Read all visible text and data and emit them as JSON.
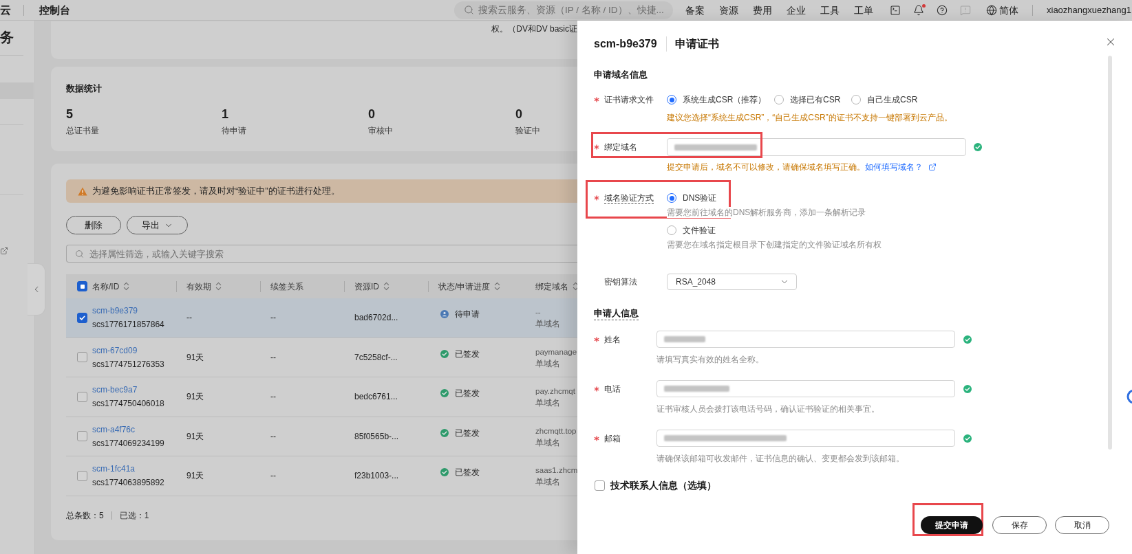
{
  "top_bar": {
    "brand": "云",
    "title": "控制台",
    "search": {
      "placeholder": "搜索云服务、资源（IP / 名称 / ID）、快捷..."
    },
    "nav": [
      "备案",
      "资源",
      "费用",
      "企业",
      "工具",
      "工单"
    ],
    "notifications": {
      "unread": true
    },
    "language": "简体",
    "user": "xiaozhangxuezhang1"
  },
  "sidebar": {
    "heading": "务",
    "items": [
      {
        "selected": true
      }
    ]
  },
  "intro": {
    "text": "权。（DV和DV basic证"
  },
  "stats": {
    "title": "数据统计",
    "items": [
      {
        "value": "5",
        "label": "总证书量"
      },
      {
        "value": "1",
        "label": "待申请"
      },
      {
        "value": "0",
        "label": "审核中"
      },
      {
        "value": "0",
        "label": "验证中"
      }
    ]
  },
  "notice": {
    "text": "为避免影响证书正常签发，请及时对“验证中”的证书进行处理。"
  },
  "toolbar": {
    "buttons": [
      {
        "label": "删除",
        "kind": "plain"
      },
      {
        "label": "导出",
        "kind": "dropdown"
      }
    ]
  },
  "filter": {
    "placeholder": "选择属性筛选，或输入关键字搜索"
  },
  "table": {
    "select_all": {
      "indeterminate": true
    },
    "columns": [
      {
        "label": "名称/ID",
        "sortable": true
      },
      {
        "label": "有效期",
        "sortable": true
      },
      {
        "label": "续签关系",
        "sortable": false
      },
      {
        "label": "资源ID",
        "sortable": true
      },
      {
        "label": "状态/申请进度",
        "sortable": true
      },
      {
        "label": "绑定域名",
        "sortable": true
      }
    ],
    "rows": [
      {
        "selected": true,
        "name": "scm-b9e379",
        "id": "scs1776171857864",
        "validity": "--",
        "renewal": "--",
        "resource_id": "bad6702d...",
        "status": {
          "kind": "pending",
          "label": "待申请"
        },
        "domain": "--",
        "domain_type": "单域名"
      },
      {
        "selected": false,
        "name": "scm-67cd09",
        "id": "scs1774751276353",
        "validity": "91天",
        "renewal": "--",
        "resource_id": "7c5258cf-...",
        "status": {
          "kind": "issued",
          "label": "已签发"
        },
        "domain": "paymanage",
        "domain_type": "单域名"
      },
      {
        "selected": false,
        "name": "scm-bec9a7",
        "id": "scs1774750406018",
        "validity": "91天",
        "renewal": "--",
        "resource_id": "bedc6761...",
        "status": {
          "kind": "issued",
          "label": "已签发"
        },
        "domain": "pay.zhcmqt",
        "domain_type": "单域名"
      },
      {
        "selected": false,
        "name": "scm-a4f76c",
        "id": "scs1774069234199",
        "validity": "91天",
        "renewal": "--",
        "resource_id": "85f0565b-...",
        "status": {
          "kind": "issued",
          "label": "已签发"
        },
        "domain": "zhcmqtt.top",
        "domain_type": "单域名"
      },
      {
        "selected": false,
        "name": "scm-1fc41a",
        "id": "scs1774063895892",
        "validity": "91天",
        "renewal": "--",
        "resource_id": "f23b1003-...",
        "status": {
          "kind": "issued",
          "label": "已签发"
        },
        "domain": "saas1.zhcm",
        "domain_type": "单域名"
      }
    ]
  },
  "footer": {
    "total": "总条数：5",
    "selected": "已选：1"
  },
  "drawer": {
    "resource_name": "scm-b9e379",
    "title": "申请证书",
    "domain_section": {
      "title": "申请域名信息"
    },
    "csr": {
      "label": "证书请求文件",
      "required": true,
      "options": [
        {
          "label": "系统生成CSR（推荐）",
          "selected": true
        },
        {
          "label": "选择已有CSR",
          "selected": false
        },
        {
          "label": "自己生成CSR",
          "selected": false
        }
      ],
      "hint": "建议您选择“系统生成CSR”，“自己生成CSR”的证书不支持一键部署到云产品。"
    },
    "domain": {
      "label": "绑定域名",
      "required": true,
      "blurred": true,
      "valid": true,
      "highlight": true,
      "hint": "提交申请后，域名不可以修改，请确保域名填写正确。",
      "link": "如何填写域名？"
    },
    "validation": {
      "label": "域名验证方式",
      "required": true,
      "tooltip": true,
      "highlight": true,
      "options": [
        {
          "label": "DNS验证",
          "selected": true,
          "hint": "需要您前往域名的DNS解析服务商，添加一条解析记录"
        },
        {
          "label": "文件验证",
          "selected": false,
          "hint": "需要您在域名指定根目录下创建指定的文件验证域名所有权"
        }
      ]
    },
    "key_algorithm": {
      "label": "密钥算法",
      "required": false,
      "value": "RSA_2048"
    },
    "applicant_section": {
      "title": "申请人信息",
      "tooltip": true
    },
    "applicant_fields": [
      {
        "label": "姓名",
        "required": true,
        "blurred": true,
        "valid": true,
        "hint": "请填写真实有效的姓名全称。"
      },
      {
        "label": "电话",
        "required": true,
        "blurred": true,
        "valid": true,
        "hint": "证书审核人员会拨打该电话号码，确认证书验证的相关事宜。"
      },
      {
        "label": "邮箱",
        "required": true,
        "blurred": true,
        "valid": true,
        "hint": "请确保该邮箱可收发邮件，证书信息的确认、变更都会发到该邮箱。"
      }
    ],
    "tech_contact": {
      "label": "技术联系人信息（选填）",
      "checked": false
    },
    "actions": [
      {
        "label": "提交申请",
        "kind": "primary",
        "highlight": true
      },
      {
        "label": "保存",
        "kind": "secondary",
        "highlight": false
      },
      {
        "label": "取消",
        "kind": "secondary",
        "highlight": false
      }
    ]
  }
}
